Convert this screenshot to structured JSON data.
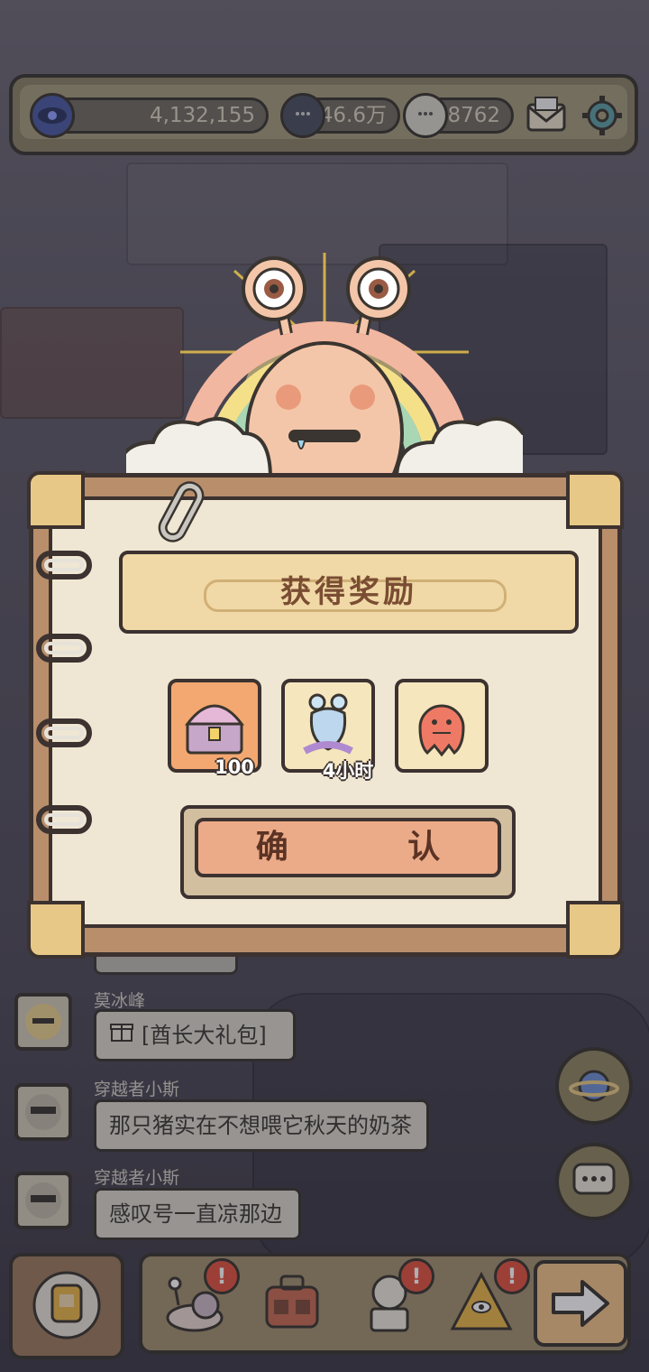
{
  "topbar": {
    "resources": [
      {
        "value": "4,132,155",
        "icon": "eye-coin-icon"
      },
      {
        "value": "46.6万",
        "icon": "dark-chat-bubble-icon"
      },
      {
        "value": "18762",
        "icon": "light-chat-bubble-icon"
      }
    ],
    "mail_icon": "envelope-icon",
    "settings_icon": "gear-icon"
  },
  "dialog": {
    "title": "获得奖励",
    "rewards": [
      {
        "icon": "treasure-chest-icon",
        "label": "100"
      },
      {
        "icon": "ghost-snail-icon",
        "label": "4小时"
      },
      {
        "icon": "red-ghost-icon",
        "label": ""
      }
    ],
    "confirm_label": "确 认"
  },
  "chat": {
    "messages": [
      {
        "name": "莫冰峰",
        "text": "[酋长大礼包]",
        "icon": "gift-icon"
      },
      {
        "name": "穿越者小斯",
        "text": "那只猪实在不想喂它秋天的奶茶"
      },
      {
        "name": "穿越者小斯",
        "text": "感叹号一直凉那边"
      }
    ]
  },
  "side_buttons": [
    "planet-icon",
    "chat-icon"
  ],
  "bottom_nav": {
    "items": [
      {
        "icon": "snail-icon",
        "badge": "!"
      },
      {
        "icon": "backpack-icon",
        "badge": ""
      },
      {
        "icon": "statue-icon",
        "badge": "!"
      },
      {
        "icon": "pyramid-icon",
        "badge": "!"
      }
    ],
    "next_icon": "arrow-right-icon"
  },
  "colors": {
    "frame": "#3c3230",
    "paper": "#efe7d3",
    "banner": "#f0d9a6",
    "confirm": "#ecab88",
    "badge": "#e0543f"
  }
}
